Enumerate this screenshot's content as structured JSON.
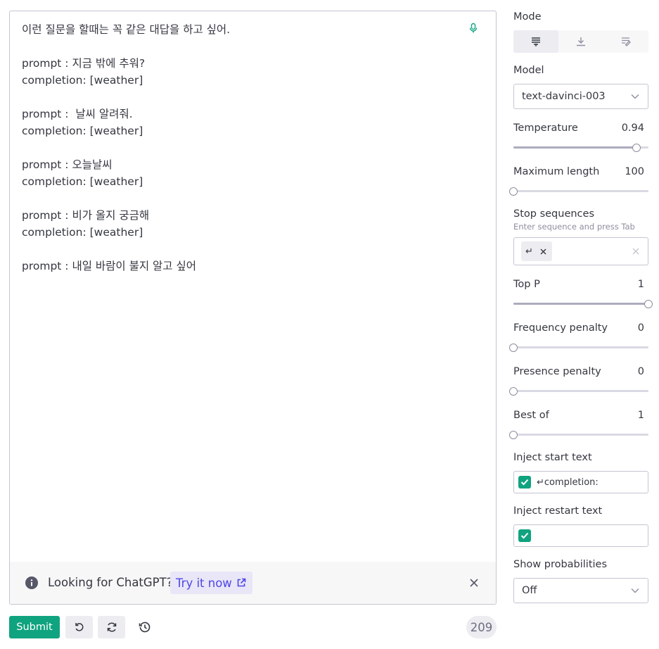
{
  "editor": {
    "lines": [
      "이런 질문을 할때는 꼭 같은 대답을 하고 싶어.",
      "",
      "prompt : 지금 밖에 추워?",
      "completion: [weather]",
      "",
      "prompt :  날씨 알려줘.",
      "completion: [weather]",
      "",
      "prompt : 오늘날씨",
      "completion: [weather]",
      "",
      "prompt : 비가 올지 궁금해",
      "completion: [weather]",
      "",
      "prompt : 내일 바람이 불지 알고 싶어"
    ],
    "mic_icon": "microphone-icon"
  },
  "banner": {
    "text": "Looking for ChatGPT?",
    "link_label": "Try it now",
    "link_icon": "external-link-icon",
    "info_icon": "info-icon",
    "close_icon": "close-icon"
  },
  "toolbar": {
    "submit_label": "Submit",
    "undo_icon": "undo-icon",
    "regenerate_icon": "regenerate-icon",
    "history_icon": "history-icon",
    "token_count": "209"
  },
  "settings": {
    "mode": {
      "label": "Mode",
      "options": [
        "complete",
        "insert",
        "edit"
      ],
      "selected": "complete"
    },
    "model": {
      "label": "Model",
      "value": "text-davinci-003"
    },
    "temperature": {
      "label": "Temperature",
      "value": "0.94",
      "fraction": 0.94
    },
    "max_length": {
      "label": "Maximum length",
      "value": "100",
      "fraction": 0.0
    },
    "stop_sequences": {
      "label": "Stop sequences",
      "hint": "Enter sequence and press Tab",
      "chip_text": "↵"
    },
    "top_p": {
      "label": "Top P",
      "value": "1",
      "fraction": 1.0
    },
    "frequency_penalty": {
      "label": "Frequency penalty",
      "value": "0",
      "fraction": 0.0
    },
    "presence_penalty": {
      "label": "Presence penalty",
      "value": "0",
      "fraction": 0.0
    },
    "best_of": {
      "label": "Best of",
      "value": "1",
      "fraction": 0.0
    },
    "inject_start": {
      "label": "Inject start text",
      "checked": true,
      "value": "↵completion:"
    },
    "inject_restart": {
      "label": "Inject restart text",
      "checked": true,
      "value": ""
    },
    "show_probabilities": {
      "label": "Show probabilities",
      "value": "Off"
    }
  },
  "colors": {
    "accent": "#10a37f",
    "link": "#4f46e5",
    "border": "#c5c5d2",
    "text": "#353740"
  }
}
